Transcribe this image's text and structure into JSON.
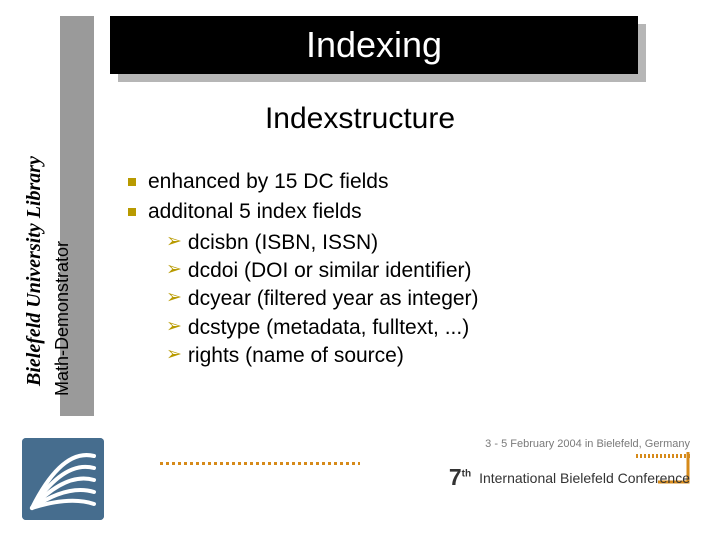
{
  "title": "Indexing",
  "subtitle": "Indexstructure",
  "sidebar": {
    "institution": "Bielefeld University Library",
    "project": "Math-Demonstrator"
  },
  "bullets": [
    "enhanced by 15 DC fields",
    "additonal 5 index fields"
  ],
  "subbullets": [
    "dcisbn (ISBN, ISSN)",
    "dcdoi (DOI or similar identifier)",
    "dcyear (filtered year as integer)",
    "dcstype (metadata, fulltext, ...)",
    "rights (name of source)"
  ],
  "footer": {
    "date_line": "3 - 5 February 2004 in Bielefeld, Germany",
    "conference_ordinal": "7",
    "conference_ordinal_suffix": "th",
    "conference_name": "International Bielefeld Conference"
  },
  "colors": {
    "accent_yellow": "#b89a00",
    "title_bg": "#000000",
    "grey_strip": "#9a9a9a",
    "orange": "#d68a1a"
  },
  "chart_data": null
}
